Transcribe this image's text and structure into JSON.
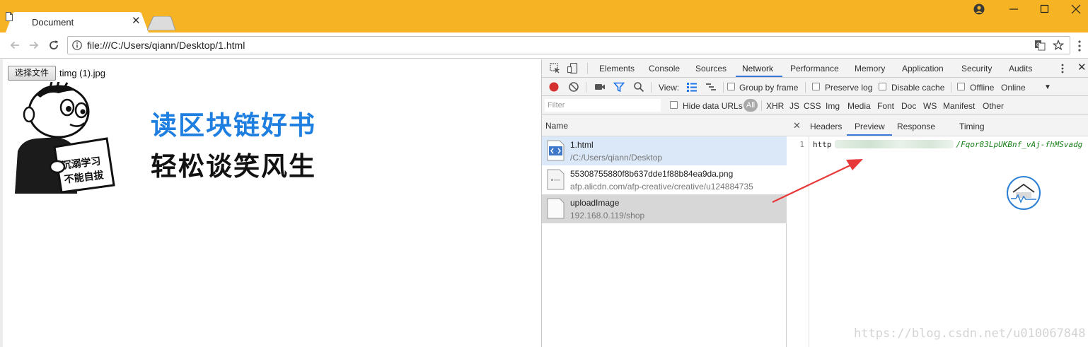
{
  "browser": {
    "tab_title": "Document",
    "url": "file:///C:/Users/qiann/Desktop/1.html",
    "theme_color": "#F6B324"
  },
  "page": {
    "file_button_label": "选择文件",
    "file_name": "timg (1).jpg",
    "meme_text_line1": "沉溺学习",
    "meme_text_line2": "不能自拔",
    "book_line1": "读区块链好书",
    "book_line2": "轻松谈笑风生",
    "accent_color": "#1E7FE0"
  },
  "devtools": {
    "tabs": [
      "Elements",
      "Console",
      "Sources",
      "Network",
      "Performance",
      "Memory",
      "Application",
      "Security",
      "Audits"
    ],
    "active_tab": "Network",
    "controls": {
      "view_label": "View:",
      "group_by_frame": "Group by frame",
      "preserve_log": "Preserve log",
      "disable_cache": "Disable cache",
      "offline": "Offline",
      "throttle": "Online"
    },
    "filter": {
      "placeholder": "Filter",
      "hide_data_urls": "Hide data URLs",
      "types": [
        "All",
        "XHR",
        "JS",
        "CSS",
        "Img",
        "Media",
        "Font",
        "Doc",
        "WS",
        "Manifest",
        "Other"
      ]
    },
    "list_header": "Name",
    "requests": [
      {
        "name": "1.html",
        "path": "/C:/Users/qiann/Desktop",
        "icon": "html-file-icon",
        "state": "selected"
      },
      {
        "name": "55308755880f8b637dde1f88b84ea9da.png",
        "path": "afp.alicdn.com/afp-creative/creative/u124884735",
        "icon": "image-file-icon",
        "state": "normal"
      },
      {
        "name": "uploadImage",
        "path": "192.168.0.119/shop",
        "icon": "blank-file-icon",
        "state": "highlighted"
      }
    ],
    "detail_tabs": [
      "Headers",
      "Preview",
      "Response",
      "Timing"
    ],
    "active_detail_tab": "Preview",
    "preview": {
      "line_number": "1",
      "prefix": "http",
      "suffix": "/Fqor83LpUKBnf_vAj-fhMSvadg"
    }
  },
  "watermark": "https://blog.csdn.net/u010067848"
}
